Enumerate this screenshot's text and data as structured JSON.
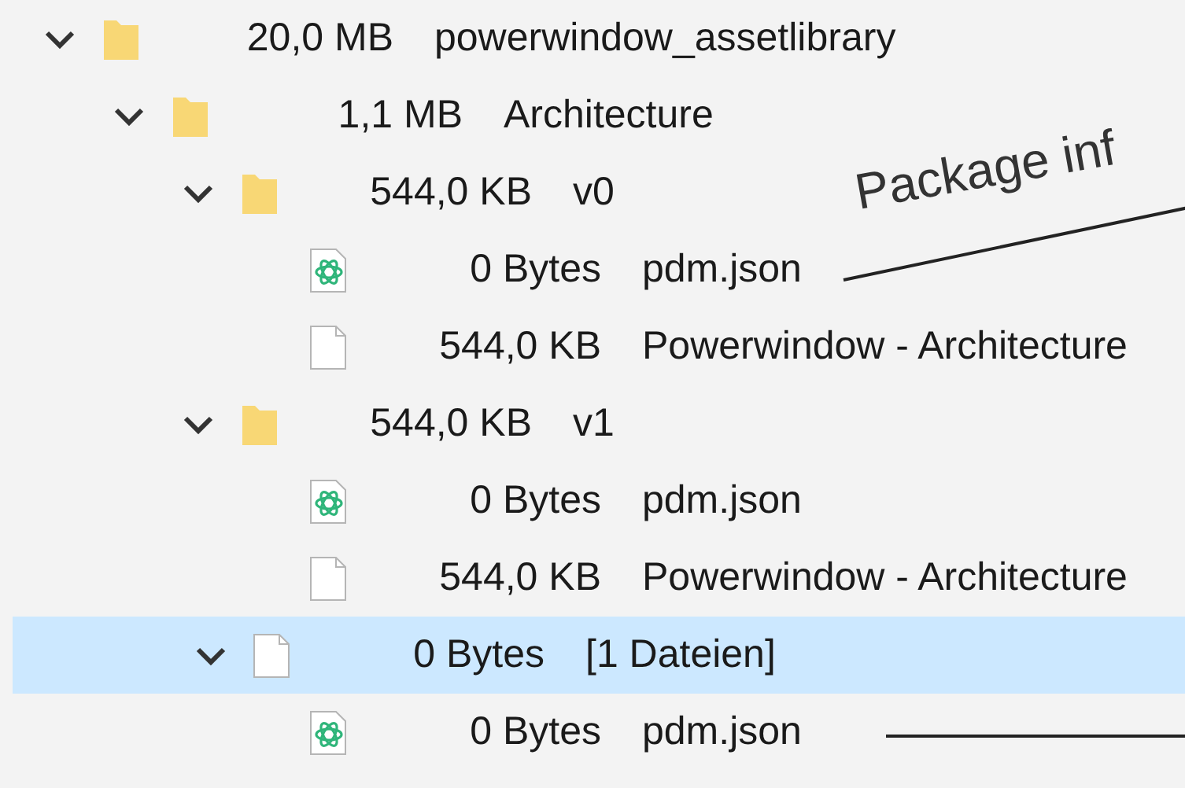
{
  "tree": [
    {
      "kind": "folder",
      "size": "20,0 MB",
      "name": "powerwindow_assetlibrary",
      "expanded": true,
      "selected": false,
      "children": [
        {
          "kind": "folder",
          "size": "1,1 MB",
          "name": "Architecture",
          "expanded": true,
          "selected": false,
          "children": [
            {
              "kind": "folder",
              "size": "544,0 KB",
              "name": "v0",
              "expanded": true,
              "selected": false,
              "children": [
                {
                  "kind": "json",
                  "size": "0 Bytes",
                  "name": "pdm.json",
                  "selected": false
                },
                {
                  "kind": "file",
                  "size": "544,0 KB",
                  "name": "Powerwindow - Architecture",
                  "selected": false
                }
              ]
            },
            {
              "kind": "folder",
              "size": "544,0 KB",
              "name": "v1",
              "expanded": true,
              "selected": false,
              "children": [
                {
                  "kind": "json",
                  "size": "0 Bytes",
                  "name": "pdm.json",
                  "selected": false
                },
                {
                  "kind": "file",
                  "size": "544,0 KB",
                  "name": "Powerwindow - Architecture",
                  "selected": false
                }
              ]
            },
            {
              "kind": "file",
              "size": "0 Bytes",
              "name": "[1 Dateien]",
              "expanded": true,
              "selected": true,
              "children": [
                {
                  "kind": "json",
                  "size": "0 Bytes",
                  "name": "pdm.json",
                  "selected": false
                }
              ]
            }
          ]
        }
      ]
    }
  ],
  "annotations": [
    {
      "kind": "labeled-line",
      "label": "Package inf"
    },
    {
      "kind": "line"
    }
  ]
}
